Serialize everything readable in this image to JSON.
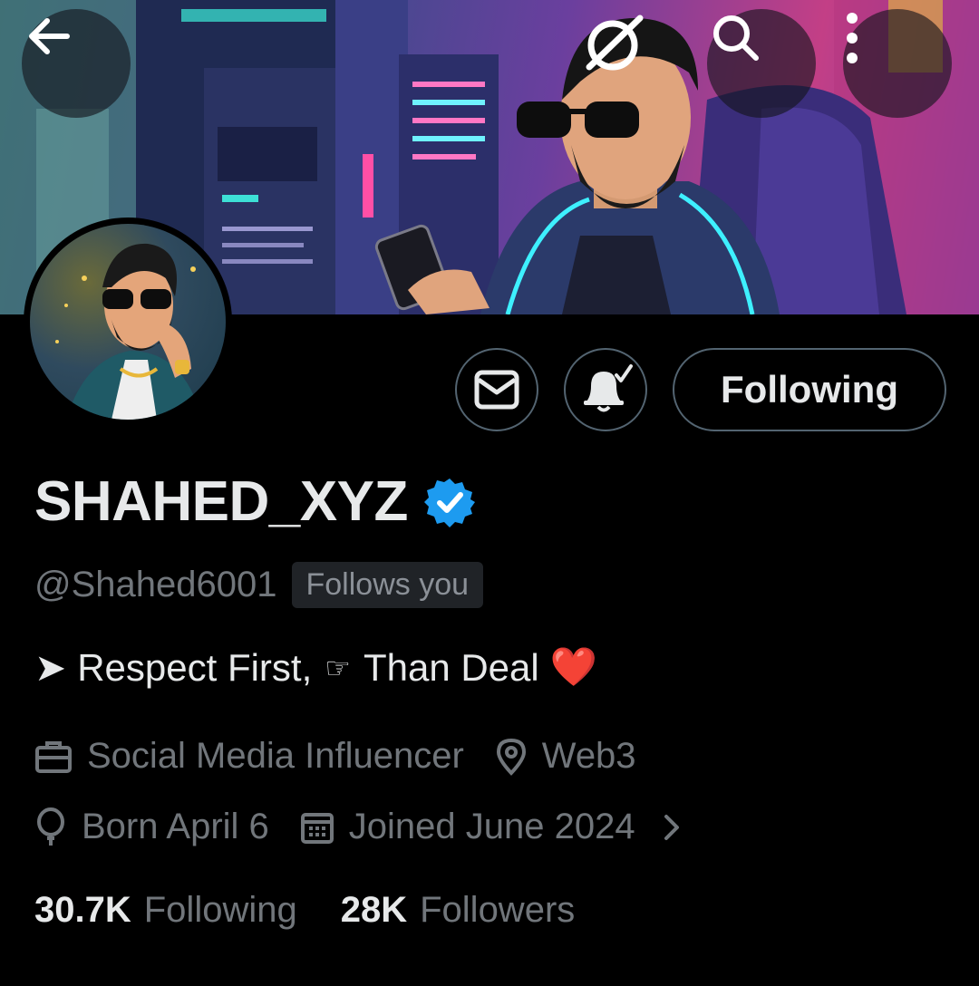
{
  "header": {
    "back_icon": "arrow-left-icon",
    "grok_icon": "grok-icon",
    "search_icon": "search-icon",
    "more_icon": "more-vertical-icon"
  },
  "profile": {
    "display_name": "SHAHED_XYZ",
    "handle": "@Shahed6001",
    "follows_you": "Follows you",
    "bio": {
      "arrow": "➤",
      "part1": "Respect First,",
      "hand": "☞",
      "part2": "Than Deal",
      "heart": "❤️"
    },
    "category": "Social Media Influencer",
    "location": "Web3",
    "birthday": "Born April 6",
    "joined": "Joined June 2024",
    "following_count": "30.7K",
    "following_label": "Following",
    "followers_count": "28K",
    "followers_label": "Followers"
  },
  "actions": {
    "following_button": "Following",
    "message_icon": "mail-icon",
    "notify_icon": "bell-check-icon"
  },
  "colors": {
    "background": "#000000",
    "text_primary": "#e7e9ea",
    "text_secondary": "#71767b",
    "border": "#536471",
    "verified": "#1d9bf0"
  }
}
